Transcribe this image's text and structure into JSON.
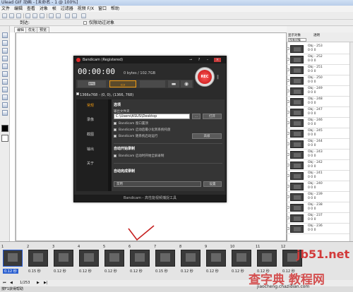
{
  "window": {
    "title": "Ulead GIF 动画 - [未命名 - 1 @ 100%]"
  },
  "menu": [
    "文件",
    "编辑",
    "查看",
    "对象",
    "帧",
    "过滤器",
    "视频 F/X",
    "窗口",
    "帮助"
  ],
  "toolbar2": {
    "label": "到达:",
    "checkbox_label": "仅限动过对象"
  },
  "tabs": [
    "编辑",
    "优化",
    "预览"
  ],
  "right_panel": {
    "label_a": "显示对象",
    "label_b": "透明",
    "dropdown": "所有对象"
  },
  "frames": [
    {
      "text": "Obj - 253",
      "sub": "0 0  0"
    },
    {
      "text": "Obj - 252",
      "sub": "0 0  0"
    },
    {
      "text": "Obj - 251",
      "sub": "0 0  0"
    },
    {
      "text": "Obj - 250",
      "sub": "0 0  0"
    },
    {
      "text": "Obj - 249",
      "sub": "0 0  0"
    },
    {
      "text": "Obj - 248",
      "sub": "0 0  0"
    },
    {
      "text": "Obj - 247",
      "sub": "0 0  0"
    },
    {
      "text": "Obj - 246",
      "sub": "0 0  0"
    },
    {
      "text": "Obj - 245",
      "sub": "0 0  0"
    },
    {
      "text": "Obj - 244",
      "sub": "0 0  0"
    },
    {
      "text": "Obj - 243",
      "sub": "0 0  0"
    },
    {
      "text": "Obj - 242",
      "sub": "0 0  0"
    },
    {
      "text": "Obj - 241",
      "sub": "0 0  0"
    },
    {
      "text": "Obj - 240",
      "sub": "0 0  0"
    },
    {
      "text": "Obj - 239",
      "sub": "0 0  0"
    },
    {
      "text": "Obj - 238",
      "sub": "0 0  0"
    },
    {
      "text": "Obj - 237",
      "sub": "0 0  0"
    },
    {
      "text": "Obj - 236",
      "sub": "0 0  0"
    }
  ],
  "bandicam": {
    "title": "Bandicam (Registered)",
    "timer": "00:00:00",
    "size": "0 bytes / 102.7GB",
    "rec": "REC",
    "area": "1366x768 - (0, 0), (1366, 768)",
    "nav": [
      "常规",
      "录像",
      "截图",
      "输出",
      "关于"
    ],
    "section_title": "选项",
    "output_label": "输出文件夹",
    "folder_value": "C:\\Users\\ASUS\\Desktop",
    "browse_btn": "...",
    "open_btn": "打开",
    "options": [
      "Bandicam 窗口置顶",
      "Bandicam 启动后最小化到系统托盘",
      "Bandicam 随系统启动运行"
    ],
    "advanced_btn": "高级",
    "autostart_title": "自动开始录制",
    "autostart_option": "Bandicam 启动时开始全屏录制",
    "autocomplete_title": "自动完成录制",
    "autocomplete_value": "禁用",
    "settings_btn": "设置",
    "status": "Bandicam - 高性能视频捕捉工具"
  },
  "filmstrip": [
    {
      "num": "1",
      "dur": "0.12 秒"
    },
    {
      "num": "2",
      "dur": "0.15 秒"
    },
    {
      "num": "3",
      "dur": "0.12 秒"
    },
    {
      "num": "4",
      "dur": "0.12 秒"
    },
    {
      "num": "5",
      "dur": "0.12 秒"
    },
    {
      "num": "6",
      "dur": "0.12 秒"
    },
    {
      "num": "7",
      "dur": "0.15 秒"
    },
    {
      "num": "8",
      "dur": "0.12 秒"
    },
    {
      "num": "9",
      "dur": "0.12 秒"
    },
    {
      "num": "10",
      "dur": "0.12 秒"
    },
    {
      "num": "11",
      "dur": "0.12 秒"
    },
    {
      "num": "12",
      "dur": "0.12 秒"
    }
  ],
  "nav_controls": {
    "page": "1/253"
  },
  "statusbar": {
    "text": "按F1获得帮助"
  },
  "watermark": {
    "main": "查字典 教程网",
    "url": "jiaocheng.chazidian.com"
  },
  "extra_watermark": "jb51.net"
}
